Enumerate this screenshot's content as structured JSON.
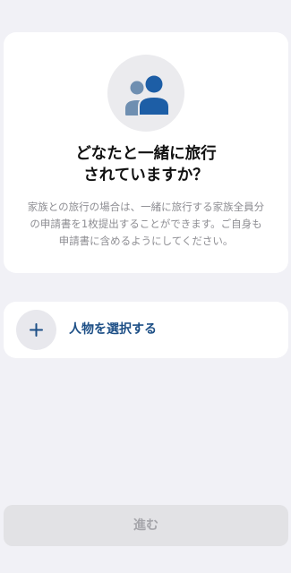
{
  "info_card": {
    "icon": "people-icon",
    "title_lines": [
      "どなたと一緒に旅行",
      "されていますか？"
    ],
    "description_lines": [
      "家族との旅行の場合は、一緒に旅行する家族全員分",
      "の申請書を1枚提出することができます。ご自身も",
      "申請書に含めるようにしてください。"
    ]
  },
  "select_person": {
    "icon": "plus-icon",
    "label": "人物を選択する"
  },
  "next_button": {
    "label": "進む",
    "state": "disabled"
  },
  "colors": {
    "background": "#f1f1f6",
    "card": "#ffffff",
    "accent": "#1d4f86",
    "person_back": "#6f8fb1",
    "person_front": "#1d5ea6",
    "muted_text": "#8e8e93",
    "disabled_button": "#e2e2e5",
    "disabled_text": "#a5a5aa"
  }
}
